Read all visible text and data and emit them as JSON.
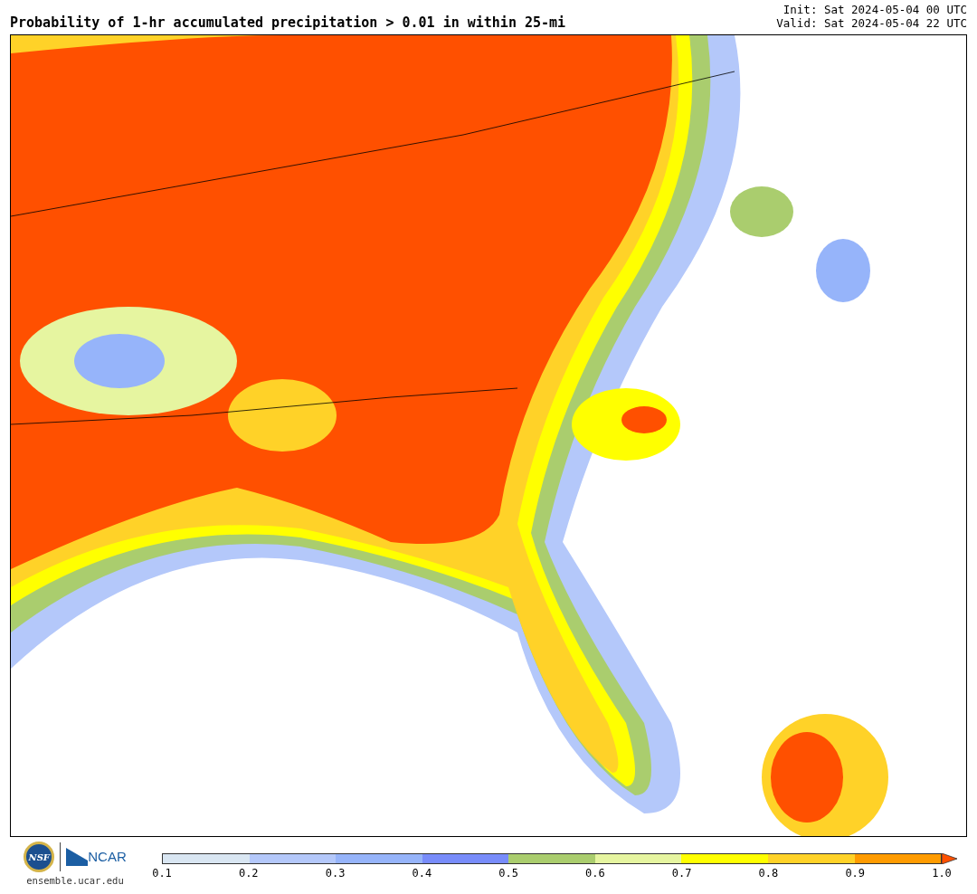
{
  "title": "Probability of 1-hr accumulated precipitation > 0.01 in within 25-mi",
  "init": "Init: Sat 2024-05-04 00 UTC",
  "valid": "Valid: Sat 2024-05-04 22 UTC",
  "logos": {
    "nsf": "NSF",
    "ncar": "NCAR",
    "url": "ensemble.ucar.edu"
  },
  "colorbar": {
    "bins": [
      {
        "color": "#d9e6f2"
      },
      {
        "color": "#b4c8fa"
      },
      {
        "color": "#96b4fa"
      },
      {
        "color": "#788cfa"
      },
      {
        "color": "#aacd6e"
      },
      {
        "color": "#e6f5a0"
      },
      {
        "color": "#ffff00"
      },
      {
        "color": "#ffd228"
      },
      {
        "color": "#ff9b00"
      }
    ],
    "extend": {
      "color": "#ff5000"
    },
    "ticks": [
      "0.1",
      "0.2",
      "0.3",
      "0.4",
      "0.5",
      "0.6",
      "0.7",
      "0.8",
      "0.9",
      "1.0"
    ]
  }
}
